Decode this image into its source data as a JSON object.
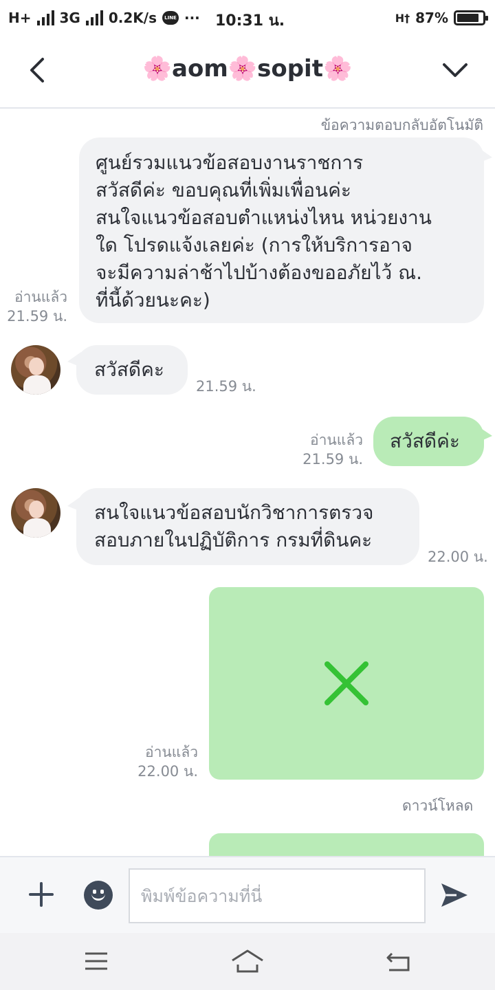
{
  "status_bar": {
    "network_left": "H+",
    "network_3g": "3G",
    "speed": "0.2K/s",
    "line_badge": "LINE",
    "more": "···",
    "time": "10:31 น.",
    "network_right": "H†",
    "battery_percent": "87%",
    "battery_level": 0.87
  },
  "header": {
    "title": "🌸aom🌸sopit🌸",
    "back_icon": "chevron-left-icon",
    "menu_icon": "chevron-down-icon"
  },
  "chat": {
    "auto_reply_note": "ข้อความตอบกลับอัตโนมัติ",
    "messages": [
      {
        "direction": "out",
        "text": "ศูนย์รวมแนวข้อสอบงานราชการ\nสวัสดีค่ะ  ขอบคุณที่เพิ่มเพื่อนค่ะ\nสนใจแนวข้อสอบตำแหน่งไหน หน่วยงาน\nใด โปรดแจ้งเลยค่ะ   (การให้บริการอาจ\nจะมีความล่าช้าไปบ้างต้องขออภัยไว้ ณ.\nที่นี้ด้วยนะคะ)",
        "status": "อ่านแล้ว",
        "time": "21.59 น."
      },
      {
        "direction": "in",
        "text": "สวัสดีคะ",
        "time": "21.59 น."
      },
      {
        "direction": "out",
        "text": "สวัสดีค่ะ",
        "status": "อ่านแล้ว",
        "time": "21.59 น."
      },
      {
        "direction": "in",
        "text": "สนใจแนวข้อสอบนักวิชาการตรวจ\nสอบภายในปฏิบัติการ กรมที่ดินคะ",
        "time": "22.00 น."
      },
      {
        "direction": "out",
        "type": "image",
        "image_icon": "broken-image-x-icon",
        "status": "อ่านแล้ว",
        "time": "22.00 น.",
        "download_label": "ดาวน์โหลด"
      }
    ]
  },
  "input_bar": {
    "plus_icon": "plus-icon",
    "emoji_icon": "emoji-icon",
    "placeholder": "พิมพ์ข้อความที่นี่",
    "send_icon": "send-icon"
  },
  "nav_bar": {
    "menu_icon": "menu-icon",
    "home_icon": "home-icon",
    "back_icon": "back-icon"
  },
  "colors": {
    "outgoing_bubble": "#b9ebb7",
    "incoming_bubble": "#f1f2f4",
    "image_x": "#35c235",
    "text_primary": "#2c2f36",
    "text_meta": "#868b93"
  }
}
